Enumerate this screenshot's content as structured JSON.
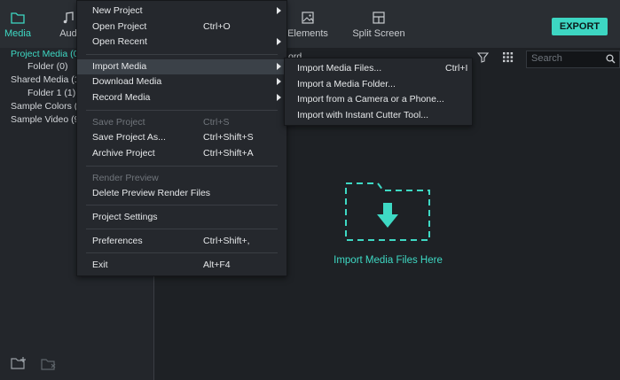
{
  "tabs": [
    {
      "label": "Media",
      "icon": "folder-icon"
    },
    {
      "label": "Aud",
      "icon": "music-note-icon"
    },
    {
      "label": "Elements",
      "icon": "image-icon"
    },
    {
      "label": "Split Screen",
      "icon": "split-screen-icon"
    }
  ],
  "export_label": "EXPORT",
  "search": {
    "placeholder": "Search"
  },
  "sort_partial": "ord",
  "media_tree": [
    {
      "label": "Project Media (0",
      "active": true
    },
    {
      "label": "Folder (0)"
    },
    {
      "label": "Shared Media (1"
    },
    {
      "label": "Folder 1 (1)"
    },
    {
      "label": "Sample Colors ("
    },
    {
      "label": "Sample Video (9"
    }
  ],
  "file_menu": [
    {
      "label": "New Project",
      "shortcut": "",
      "submenu": true
    },
    {
      "label": "Open Project",
      "shortcut": "Ctrl+O"
    },
    {
      "label": "Open Recent",
      "shortcut": "",
      "submenu": true
    },
    {
      "label": "Import Media",
      "shortcut": "",
      "submenu": true,
      "highlight": true
    },
    {
      "label": "Download Media",
      "shortcut": "",
      "submenu": true
    },
    {
      "label": "Record Media",
      "shortcut": "",
      "submenu": true
    },
    {
      "label": "Save Project",
      "shortcut": "Ctrl+S",
      "disabled": true
    },
    {
      "label": "Save Project As...",
      "shortcut": "Ctrl+Shift+S"
    },
    {
      "label": "Archive Project",
      "shortcut": "Ctrl+Shift+A"
    },
    {
      "label": "Render Preview",
      "shortcut": "",
      "disabled": true
    },
    {
      "label": "Delete Preview Render Files",
      "shortcut": ""
    },
    {
      "label": "Project Settings",
      "shortcut": ""
    },
    {
      "label": "Preferences",
      "shortcut": "Ctrl+Shift+,"
    },
    {
      "label": "Exit",
      "shortcut": "Alt+F4"
    }
  ],
  "import_submenu": [
    {
      "label": "Import Media Files...",
      "shortcut": "Ctrl+I"
    },
    {
      "label": "Import a Media Folder...",
      "shortcut": ""
    },
    {
      "label": "Import from a Camera or a Phone...",
      "shortcut": ""
    },
    {
      "label": "Import with Instant Cutter Tool...",
      "shortcut": ""
    }
  ],
  "drop_zone_label": "Import Media Files Here",
  "colors": {
    "accent": "#3ed9c4",
    "menu_bg": "#25282d",
    "highlight": "#3b4148"
  }
}
